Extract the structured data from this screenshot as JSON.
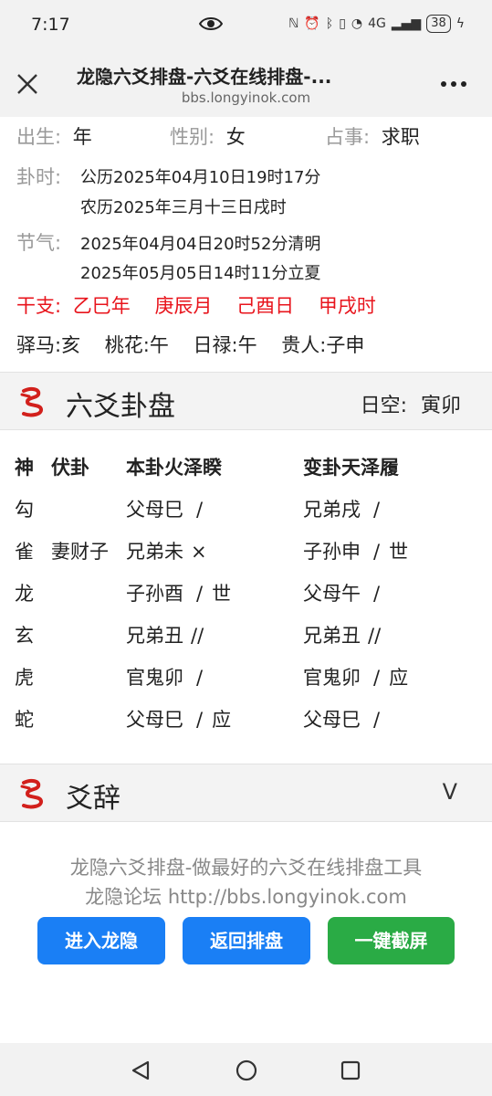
{
  "status_bar": {
    "time": "7:17",
    "battery": "38",
    "signal": "4G"
  },
  "nav": {
    "title": "龙隐六爻排盘-六爻在线排盘-...",
    "url": "bbs.longyinok.com"
  },
  "info": {
    "birth_label": "出生:",
    "birth_value": "年",
    "gender_label": "性别:",
    "gender_value": "女",
    "matter_label": "占事:",
    "matter_value": "求职",
    "time_label": "卦时:",
    "solar": "公历2025年04月10日19时17分",
    "lunar": "农历2025年三月十三日戌时",
    "solar_term_label": "节气:",
    "term1": "2025年04月04日20时52分清明",
    "term2": "2025年05月05日14时11分立夏",
    "ganzhi_label": "干支:",
    "ganzhi": [
      "乙巳年",
      "庚辰月",
      "己酉日",
      "甲戌时"
    ],
    "shensha": [
      "驿马:亥",
      "桃花:午",
      "日禄:午",
      "贵人:子申"
    ]
  },
  "paipan": {
    "title": "六爻卦盘",
    "kong_label": "日空:",
    "kong_value": "寅卯",
    "headers": {
      "shen": "神",
      "fu": "伏卦",
      "ben": "本卦火泽睽",
      "bian": "变卦天泽履"
    },
    "rows": [
      {
        "shen": "勾",
        "fu": "",
        "ben": "父母巳",
        "ben_yao": "/",
        "ben_mark": "",
        "bian": "兄弟戌",
        "bian_yao": "/",
        "bian_mark": ""
      },
      {
        "shen": "雀",
        "fu": "妻财子",
        "ben": "兄弟未",
        "ben_yao": "×",
        "ben_mark": "",
        "bian": "子孙申",
        "bian_yao": "/",
        "bian_mark": "世"
      },
      {
        "shen": "龙",
        "fu": "",
        "ben": "子孙酉",
        "ben_yao": "/",
        "ben_mark": "世",
        "bian": "父母午",
        "bian_yao": "/",
        "bian_mark": ""
      },
      {
        "shen": "玄",
        "fu": "",
        "ben": "兄弟丑",
        "ben_yao": "//",
        "ben_mark": "",
        "bian": "兄弟丑",
        "bian_yao": "//",
        "bian_mark": ""
      },
      {
        "shen": "虎",
        "fu": "",
        "ben": "官鬼卯",
        "ben_yao": "/",
        "ben_mark": "",
        "bian": "官鬼卯",
        "bian_yao": "/",
        "bian_mark": "应"
      },
      {
        "shen": "蛇",
        "fu": "",
        "ben": "父母巳",
        "ben_yao": "/",
        "ben_mark": "应",
        "bian": "父母巳",
        "bian_yao": "/",
        "bian_mark": ""
      }
    ]
  },
  "yaoci": {
    "title": "爻辞",
    "toggle": "V"
  },
  "footer": {
    "slogan": "龙隐六爻排盘-做最好的六爻在线排盘工具",
    "site": "龙隐论坛 http://bbs.longyinok.com",
    "btn_enter": "进入龙隐",
    "btn_back": "返回排盘",
    "btn_shot": "一键截屏"
  },
  "colors": {
    "red": "#e8141c",
    "blue_button": "#1a7ff5",
    "green_button": "#2aab45",
    "label_gray": "#999999"
  }
}
